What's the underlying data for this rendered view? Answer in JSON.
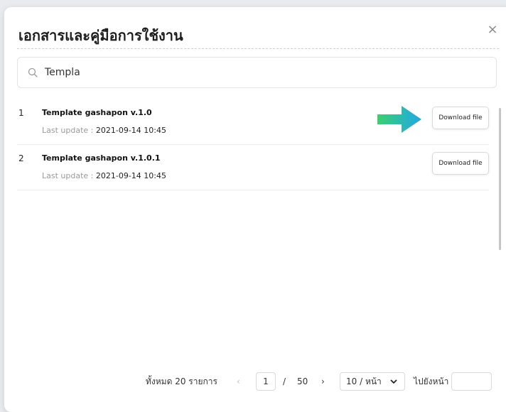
{
  "modal": {
    "title": "เอกสารและคู่มือการใช้งาน",
    "close_icon": "×"
  },
  "search": {
    "value": "Templa",
    "icon": "search-icon"
  },
  "documents": [
    {
      "index": "1",
      "title": "Template gashapon v.1.0",
      "meta_label": "Last update : ",
      "meta_date": "2021-09-14 10:45",
      "button_label": "Download file"
    },
    {
      "index": "2",
      "title": "Template gashapon v.1.0.1",
      "meta_label": "Last update : ",
      "meta_date": "2021-09-14 10:45",
      "button_label": "Download file"
    }
  ],
  "pagination": {
    "total_label": "ทั้งหมด  20  รายการ",
    "prev_icon": "‹",
    "current_page": "1",
    "separator": "/",
    "total_pages": "50",
    "next_icon": "›",
    "page_size": "10 / หน้า",
    "goto_label": "ไปยังหน้า"
  },
  "colors": {
    "arrow_start": "#3ccf6e",
    "arrow_end": "#1ea8e8"
  }
}
